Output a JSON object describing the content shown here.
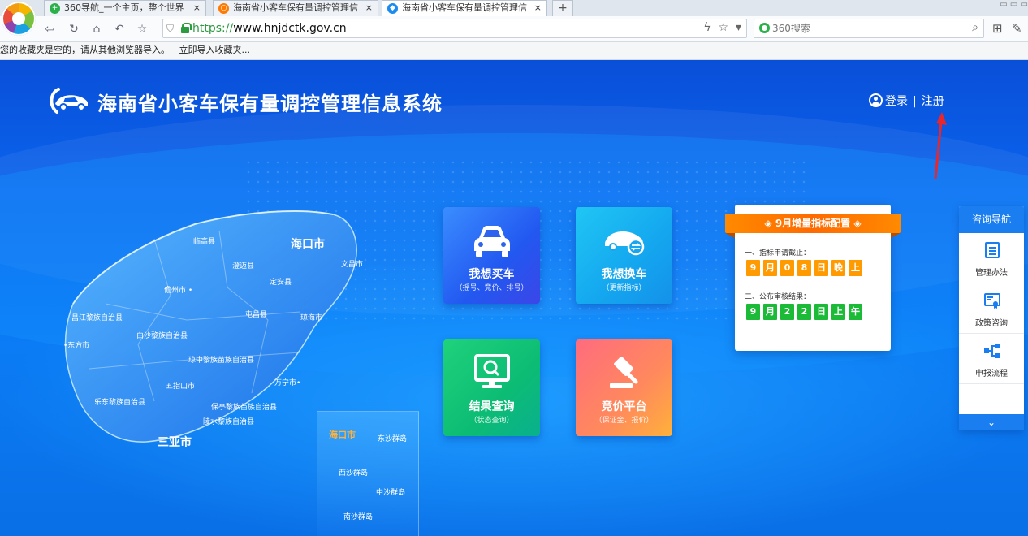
{
  "browser": {
    "tabs": [
      {
        "label": "360导航_一个主页，整个世界",
        "icon_color": "#2bb14a"
      },
      {
        "label": "海南省小客车保有量调控管理信",
        "icon_color": "#ff7a00"
      },
      {
        "label": "海南省小客车保有量调控管理信",
        "icon_color": "#1a8cf0"
      }
    ],
    "tab_close": "×",
    "new_tab": "+",
    "url_scheme": "https://",
    "url_host": "www.hnjdctk.gov.cn",
    "search_placeholder": "360搜索",
    "favbar_text": "您的收藏夹是空的，请从其他浏览器导入。",
    "favbar_link": "立即导入收藏夹..."
  },
  "header": {
    "title": "海南省小客车保有量调控管理信息系统",
    "login": "登录",
    "separator": "|",
    "register": "注册"
  },
  "map": {
    "labels": [
      {
        "text": "临高县",
        "big": false
      },
      {
        "text": "海口市",
        "big": true
      },
      {
        "text": "文昌市",
        "big": false
      },
      {
        "text": "澄迈县",
        "big": false
      },
      {
        "text": "定安县",
        "big": false
      },
      {
        "text": "儋州市 •",
        "big": false
      },
      {
        "text": "屯昌县",
        "big": false
      },
      {
        "text": "琼海市",
        "big": false
      },
      {
        "text": "昌江黎族自治县",
        "big": false
      },
      {
        "text": "白沙黎族自治县",
        "big": false
      },
      {
        "text": "•东方市",
        "big": false
      },
      {
        "text": "琼中黎族苗族自治县",
        "big": false
      },
      {
        "text": "五指山市",
        "big": false
      },
      {
        "text": "万宁市•",
        "big": false
      },
      {
        "text": "乐东黎族自治县",
        "big": false
      },
      {
        "text": "保亭黎族苗族自治县",
        "big": false
      },
      {
        "text": "陵水黎族自治县",
        "big": false
      },
      {
        "text": "三亚市",
        "big": true
      }
    ],
    "inset_labels": [
      "海口市",
      "东沙群岛",
      "西沙群岛",
      "中沙群岛",
      "南沙群岛"
    ]
  },
  "tiles": {
    "buy": {
      "name": "我想买车",
      "sub": "（摇号、竞价、排号）"
    },
    "swap": {
      "name": "我想换车",
      "sub": "（更新指标）"
    },
    "result": {
      "name": "结果查询",
      "sub": "（状态查询）"
    },
    "auction": {
      "name": "竞价平台",
      "sub": "（保证金、报价）"
    }
  },
  "notice": {
    "title": "9月增量指标配置",
    "item1": "一、指标申请截止：",
    "digits1": [
      "9",
      "月",
      "0",
      "8",
      "日",
      "晚",
      "上"
    ],
    "item2": "二、公布审核结果：",
    "digits2": [
      "9",
      "月",
      "2",
      "2",
      "日",
      "上",
      "午"
    ],
    "color_orange": "#ff9a00",
    "color_green": "#1bbb38"
  },
  "sidenav": {
    "title": "咨询导航",
    "items": [
      {
        "label": "管理办法",
        "icon": "document-icon"
      },
      {
        "label": "政策咨询",
        "icon": "certificate-icon"
      },
      {
        "label": "申报流程",
        "icon": "flow-icon"
      }
    ],
    "more": "⌄"
  }
}
